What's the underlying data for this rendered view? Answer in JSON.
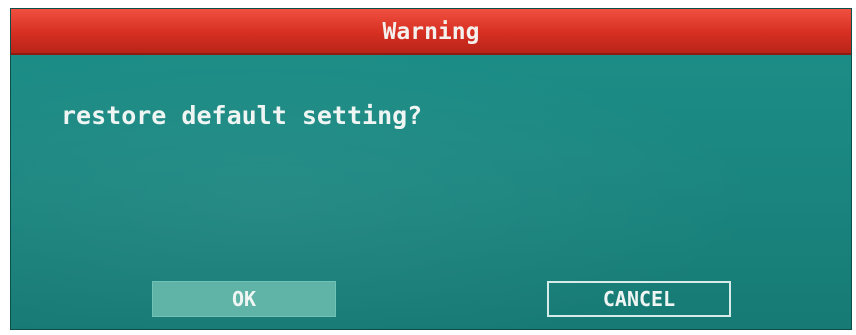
{
  "dialog": {
    "title": "Warning",
    "message": "restore default setting?",
    "buttons": {
      "ok_label": "OK",
      "cancel_label": "CANCEL"
    }
  },
  "colors": {
    "title_bar": "#d62f22",
    "body": "#1b8781",
    "ok_button": "#5fb3a7",
    "text": "#eef5f3"
  }
}
